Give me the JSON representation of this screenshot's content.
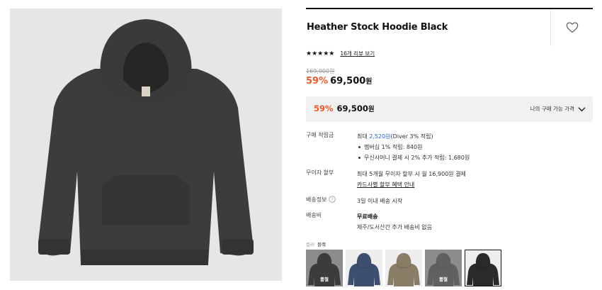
{
  "product": {
    "title": "Heather Stock Hoodie Black",
    "stars": "★★★★★",
    "review_link": "16개 리뷰 보기",
    "original_price": "169,000원",
    "discount": "59%",
    "price": "69,500",
    "price_unit": "원"
  },
  "my_price": {
    "discount": "59%",
    "price": "69,500",
    "unit": "원",
    "label": "나의 구매 가능 가격"
  },
  "details": {
    "points": {
      "label": "구매 적립금",
      "prefix": "최대 ",
      "amount": "2,520원",
      "suffix": "(Diver 3% 적립)",
      "bullets": [
        "멤버십 1% 적립: 840원",
        "무신사머니 결제 시 2% 추가 적립: 1,680원"
      ]
    },
    "installment": {
      "label": "무이자 할부",
      "text": "최대 5개월 무이자 할부 시 월 16,900원 결제",
      "link": "카드사별 할부 혜택 안내"
    },
    "shipping_info": {
      "label": "배송정보",
      "text": "3일 이내 배송 시작"
    },
    "shipping_fee": {
      "label": "배송비",
      "title": "무료배송",
      "text": "제주/도서산간 추가 배송비 없음"
    }
  },
  "colors": {
    "label": "컬러",
    "selected": "블랙",
    "sold_out_text": "품절",
    "swatches": [
      {
        "name": "charcoal",
        "color": "#3b3d3f",
        "sold_out": true
      },
      {
        "name": "navy",
        "color": "#3c4f6e",
        "sold_out": false
      },
      {
        "name": "khaki",
        "color": "#8a7d66",
        "sold_out": false
      },
      {
        "name": "gray",
        "color": "#8d8d8d",
        "sold_out": true
      },
      {
        "name": "black",
        "color": "#2a2a2a",
        "sold_out": false,
        "selected": true
      }
    ]
  },
  "theme": {
    "accent": "#f05a28",
    "link_blue": "#2a5cd6",
    "product_color": "#3c3c3c"
  }
}
